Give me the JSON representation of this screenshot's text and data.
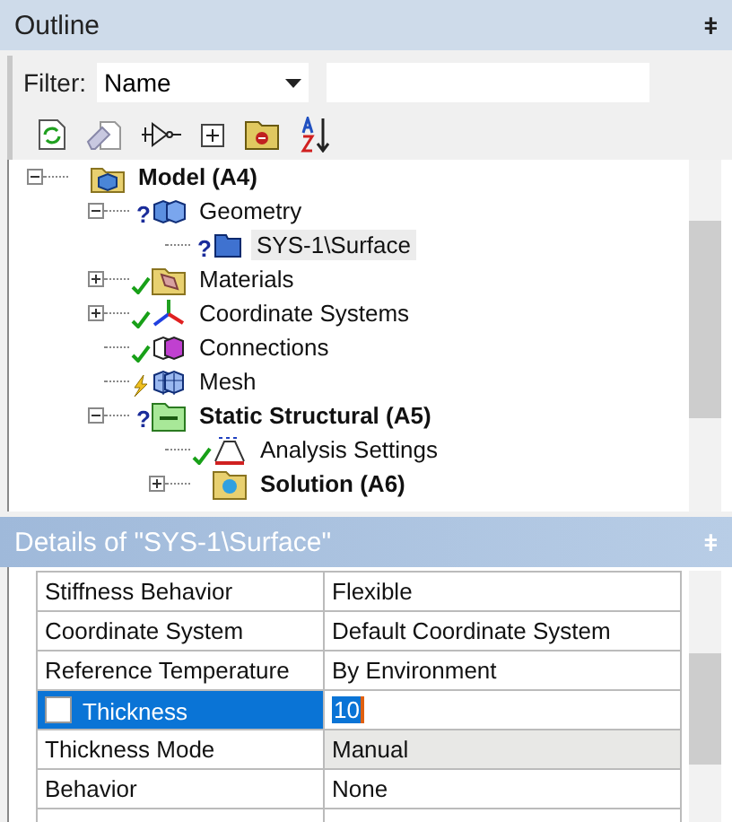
{
  "outline": {
    "title": "Outline",
    "pin": "ǂ",
    "filter": {
      "label": "Filter:",
      "value": "Name"
    },
    "tree": [
      {
        "label": "Model (A4)",
        "kind": "model",
        "done": false,
        "outdated": false,
        "bold": true,
        "expanded": true,
        "selected": false,
        "children": [
          {
            "label": "Geometry",
            "kind": "geometry",
            "mark": "?",
            "done": false,
            "outdated": false,
            "bold": false,
            "expanded": true,
            "selected": false,
            "children": [
              {
                "label": "SYS-1\\Surface",
                "kind": "surface",
                "mark": "?",
                "done": false,
                "outdated": false,
                "bold": false,
                "selected": true
              }
            ]
          },
          {
            "label": "Materials",
            "kind": "materials",
            "done": true,
            "outdated": false,
            "bold": false,
            "expanded": false,
            "selected": false
          },
          {
            "label": "Coordinate Systems",
            "kind": "coordinates",
            "done": true,
            "outdated": false,
            "bold": false,
            "expanded": false,
            "selected": false
          },
          {
            "label": "Connections",
            "kind": "connections",
            "done": true,
            "outdated": false,
            "bold": false,
            "selected": false
          },
          {
            "label": "Mesh",
            "kind": "mesh",
            "done": false,
            "outdated": true,
            "bold": false,
            "selected": false
          },
          {
            "label": "Static Structural (A5)",
            "kind": "analysis",
            "mark": "?",
            "done": false,
            "outdated": false,
            "bold": true,
            "expanded": true,
            "selected": false,
            "children": [
              {
                "label": "Analysis Settings",
                "kind": "settings",
                "done": true,
                "outdated": false,
                "bold": false,
                "selected": false
              },
              {
                "label": "Solution (A6)",
                "kind": "solution",
                "done": false,
                "outdated": false,
                "bold": true,
                "expanded": false,
                "selected": false
              }
            ]
          }
        ]
      }
    ]
  },
  "details": {
    "title": "Details of \"SYS-1\\Surface\"",
    "pin": "ǂ",
    "rows": [
      {
        "label": "Stiffness Behavior",
        "value": "Flexible",
        "kind": "plain",
        "selected": false,
        "readonly": false
      },
      {
        "label": "Coordinate System",
        "value": "Default Coordinate System",
        "kind": "plain",
        "selected": false,
        "readonly": false
      },
      {
        "label": "Reference Temperature",
        "value": "By Environment",
        "kind": "plain",
        "selected": false,
        "readonly": false
      },
      {
        "label": "Thickness",
        "value": "10",
        "kind": "parameter",
        "checked": false,
        "selected": true,
        "readonly": false
      },
      {
        "label": "Thickness Mode",
        "value": "Manual",
        "kind": "plain",
        "selected": false,
        "readonly": true
      },
      {
        "label": "Behavior",
        "value": "None",
        "kind": "plain",
        "selected": false,
        "readonly": false
      }
    ]
  }
}
